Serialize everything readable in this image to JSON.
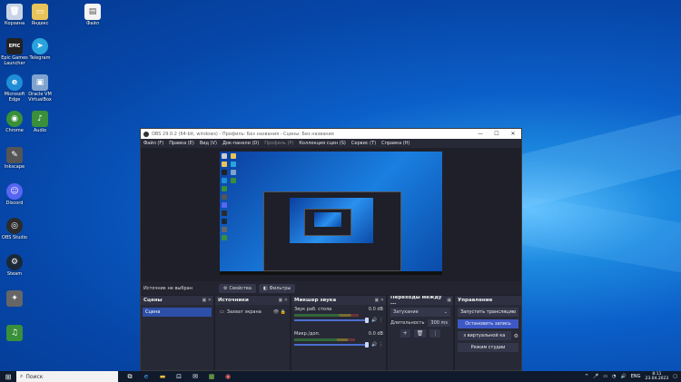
{
  "desktop_icons": [
    {
      "label": "Корзина",
      "icon": "recycle-bin-icon",
      "color": "#c8d4e6"
    },
    {
      "label": "Яндекс",
      "icon": "folder-icon",
      "color": "#e8c35a"
    },
    {
      "label": "Epic Games Launcher",
      "icon": "epic-games-icon",
      "color": "#222222",
      "glyph": "EPIC"
    },
    {
      "label": "Microsoft Edge",
      "icon": "edge-icon",
      "color": "#1f8ed6"
    },
    {
      "label": "Oracle VM VirtualBox",
      "icon": "virtualbox-icon",
      "color": "#7fa3cf"
    },
    {
      "label": "Telegram",
      "icon": "telegram-icon",
      "color": "#2aa3dd"
    },
    {
      "label": "Chrome",
      "icon": "chrome-icon",
      "color": "#3a8f3a"
    },
    {
      "label": "Discord",
      "icon": "discord-icon",
      "color": "#5865f2"
    },
    {
      "label": "OBS Studio",
      "icon": "obs-icon",
      "color": "#2b2b2b"
    },
    {
      "label": "Steam",
      "icon": "steam-icon",
      "color": "#1b2838"
    },
    {
      "label": "Inkscape",
      "icon": "inkscape-icon",
      "color": "#555555"
    },
    {
      "label": "Audio",
      "icon": "audio-app-icon",
      "color": "#3a8f3a"
    },
    {
      "label": "Файл",
      "icon": "file-icon",
      "color": "#f4f4f4"
    }
  ],
  "obs": {
    "title": "OBS 29.0.2 (64-bit, windows) - Профиль: Без названия - Сцены: Без названия",
    "menu": [
      "Файл (F)",
      "Правка (E)",
      "Вид (V)",
      "Док-панели (D)",
      "Профиль (P)",
      "Коллекция сцен (S)",
      "Сервис (T)",
      "Справка (H)"
    ],
    "no_source": "Источник не выбран",
    "properties_label": "Свойства",
    "filters_label": "Фильтры",
    "scenes": {
      "title": "Сцены",
      "items": [
        "Сцена"
      ]
    },
    "sources": {
      "title": "Источники",
      "items": [
        {
          "label": "Захват экрана",
          "icon": "monitor-icon"
        }
      ]
    },
    "mixer": {
      "title": "Микшер звука",
      "channels": [
        {
          "name": "Звук раб. стола",
          "db": "0.0 dB",
          "level": 0.72
        },
        {
          "name": "Микр./доп.",
          "db": "0.0 dB",
          "level": 0.68
        }
      ]
    },
    "transitions": {
      "title": "Переходы между ...",
      "selected": "Затухание",
      "duration_label": "Длительность",
      "duration_value": "300 ms"
    },
    "controls": {
      "title": "Управление",
      "buttons": [
        "Запустить трансляцию",
        "Остановить запись",
        "з виртуальной ка",
        "Режим студии"
      ]
    }
  },
  "taskbar": {
    "search_placeholder": "Поиск",
    "lang": "ENG",
    "time": "8:11",
    "date": "23.04.2023"
  }
}
